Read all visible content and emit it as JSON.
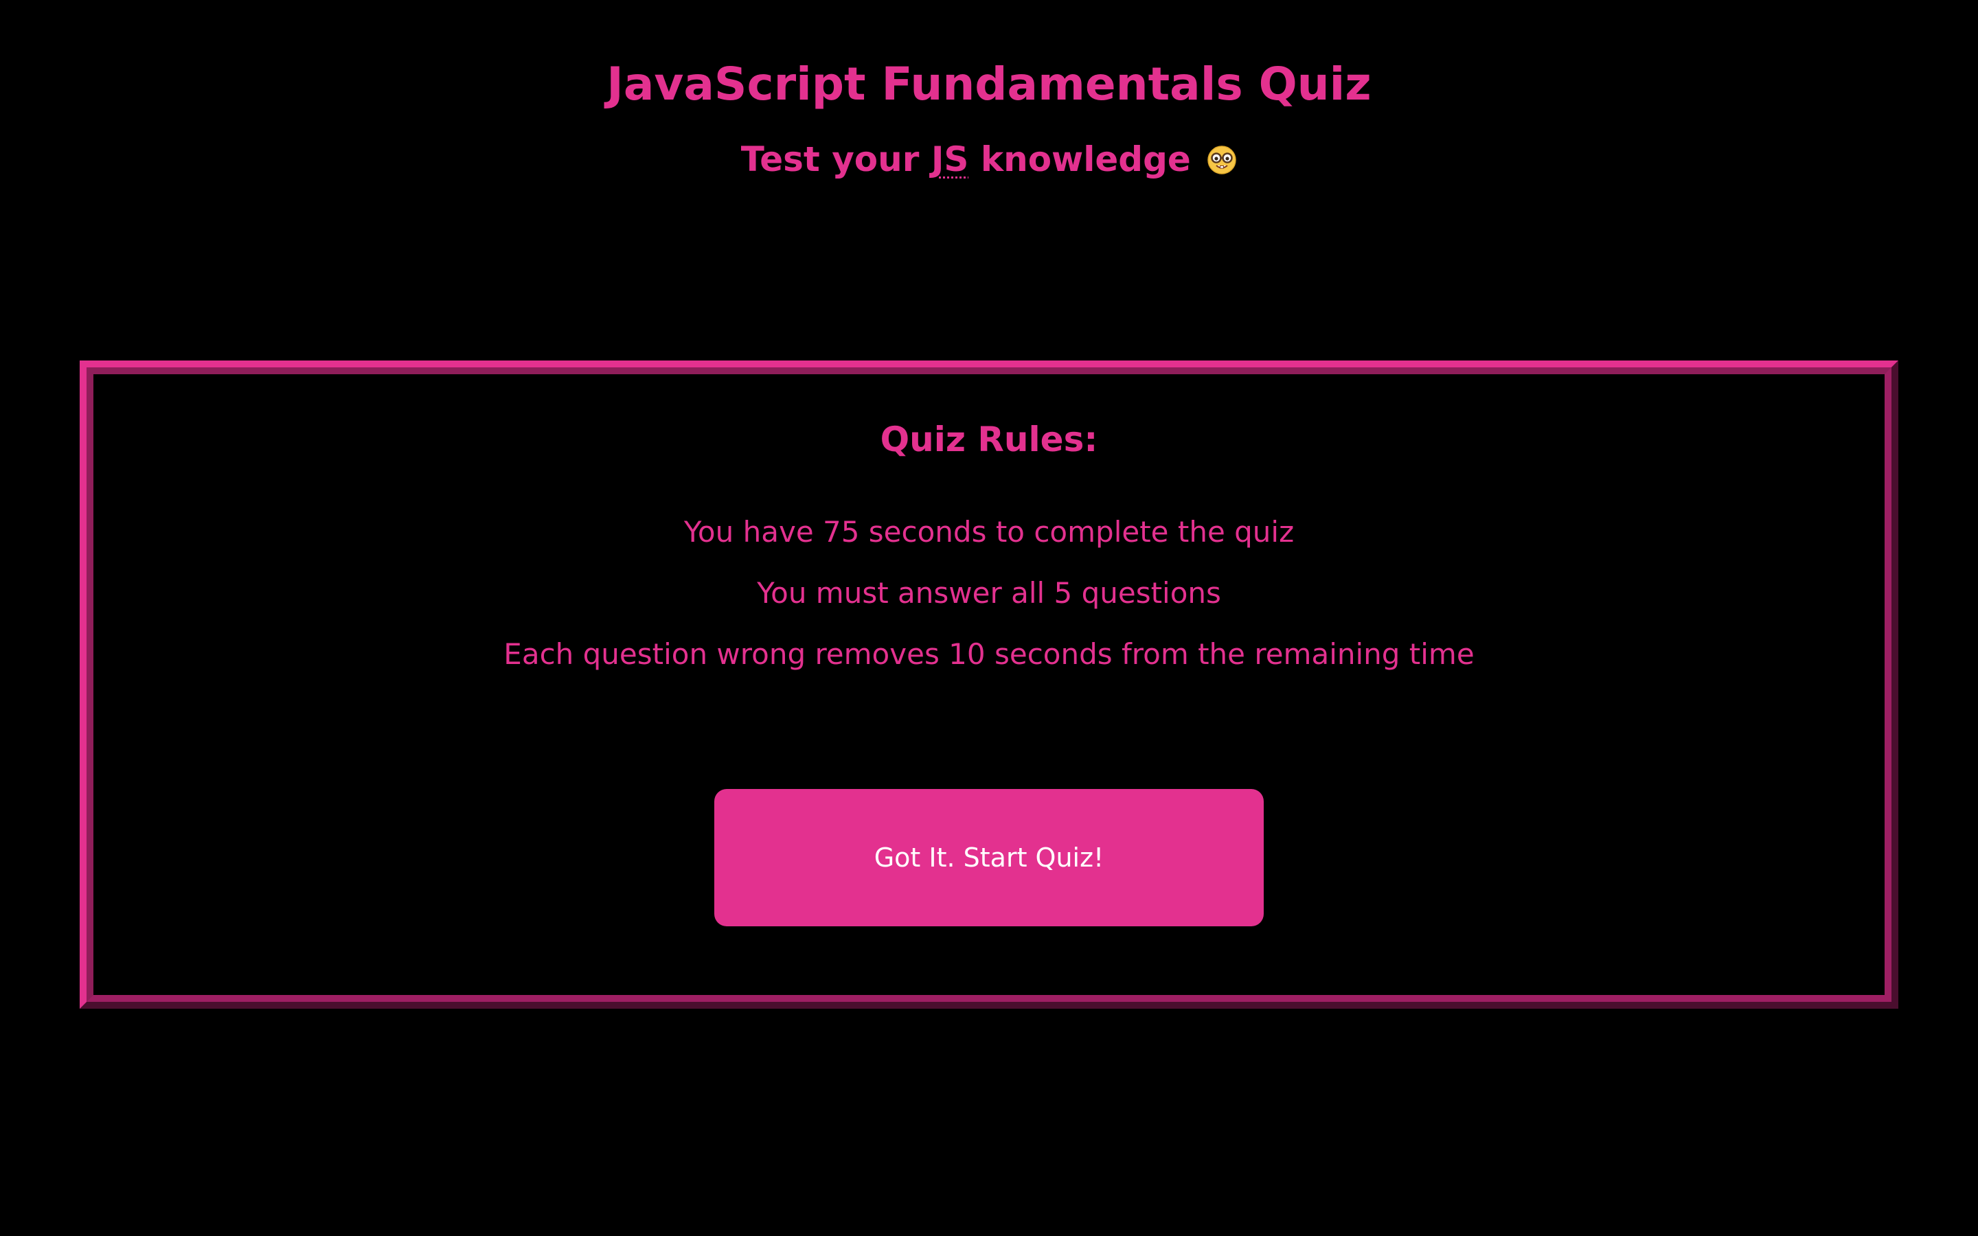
{
  "header": {
    "title": "JavaScript Fundamentals Quiz",
    "subtitle_prefix": "Test your ",
    "subtitle_abbr": "JS",
    "subtitle_suffix": " knowledge",
    "subtitle_emoji": "nerd-face-icon"
  },
  "rules": {
    "heading": "Quiz Rules:",
    "items": [
      "You have 75 seconds to complete the quiz",
      "You must answer all 5 questions",
      "Each question wrong removes 10 seconds from the remaining time"
    ],
    "start_button_label": "Got It. Start Quiz!"
  },
  "colors": {
    "background": "#000000",
    "accent": "#e3318f",
    "button_text": "#ffffff"
  }
}
